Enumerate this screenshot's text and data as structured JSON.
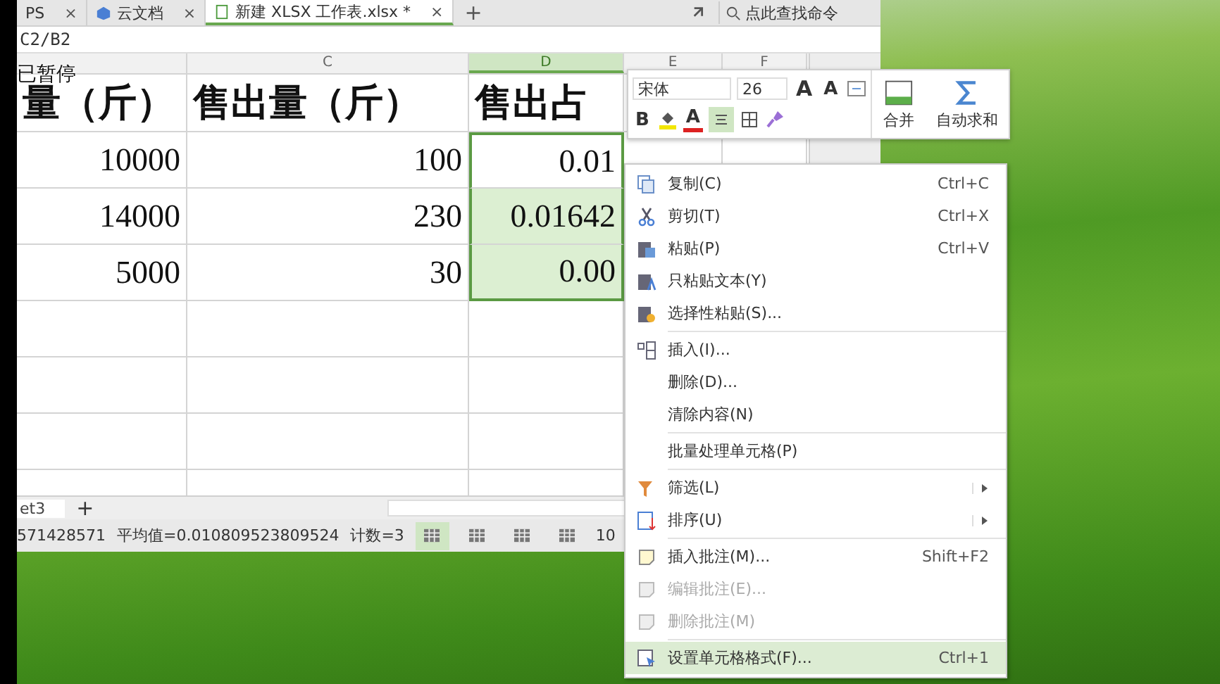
{
  "tabs": [
    {
      "label": "PS",
      "close": "×",
      "selected": false
    },
    {
      "label": "云文档",
      "close": "×",
      "selected": false
    },
    {
      "label": "新建 XLSX 工作表.xlsx *",
      "close": "×",
      "selected": true
    }
  ],
  "new_tab": "+",
  "search": {
    "placeholder": "点此查找命令"
  },
  "formula_bar": {
    "value": "C2/B2"
  },
  "paused_overlay": "已暂停",
  "sheet": {
    "columns": [
      {
        "label": "C",
        "selected": false
      },
      {
        "label": "D",
        "selected": true
      },
      {
        "label": "E",
        "selected": false
      },
      {
        "label": "F",
        "selected": false
      }
    ],
    "header_row": [
      "量（斤）",
      "售出量（斤）",
      "售出占"
    ],
    "rows": [
      {
        "cells": [
          {
            "text": "10000",
            "selected": false,
            "active": false
          },
          {
            "text": "100",
            "selected": false,
            "active": false
          },
          {
            "text": "0.01",
            "selected": true,
            "active": true
          }
        ]
      },
      {
        "cells": [
          {
            "text": "14000",
            "selected": false,
            "active": false
          },
          {
            "text": "230",
            "selected": false,
            "active": false
          },
          {
            "text": "0.01642",
            "selected": true,
            "active": false
          }
        ]
      },
      {
        "cells": [
          {
            "text": "5000",
            "selected": false,
            "active": false
          },
          {
            "text": "30",
            "selected": false,
            "active": false
          },
          {
            "text": "0.00",
            "selected": true,
            "active": false
          }
        ]
      }
    ]
  },
  "sheet_tabs": [
    {
      "label": "et3",
      "selected": true
    }
  ],
  "add_sheet": "+",
  "status_bar": {
    "items": [
      "571428571",
      "平均值=0.010809523809524",
      "计数=3"
    ],
    "views": [
      {
        "selected": true
      },
      {
        "selected": false
      },
      {
        "selected": false
      },
      {
        "selected": false
      }
    ],
    "zoom": "10"
  },
  "mini_toolbar": {
    "font": "宋体",
    "size": "26",
    "grow": "A",
    "shrink": "A",
    "bold": "B",
    "font_color": "A",
    "align_selected": true,
    "merge": "合并",
    "autosum": "自动求和"
  },
  "context_menu": [
    {
      "kind": "item",
      "label": "复制(C)",
      "shortcut": "Ctrl+C",
      "submenu": false,
      "disabled": false,
      "selected": false
    },
    {
      "kind": "item",
      "label": "剪切(T)",
      "shortcut": "Ctrl+X",
      "submenu": false,
      "disabled": false,
      "selected": false
    },
    {
      "kind": "item",
      "label": "粘贴(P)",
      "shortcut": "Ctrl+V",
      "submenu": false,
      "disabled": false,
      "selected": false
    },
    {
      "kind": "item",
      "label": "只粘贴文本(Y)",
      "submenu": false,
      "disabled": false,
      "selected": false
    },
    {
      "kind": "item",
      "label": "选择性粘贴(S)...",
      "submenu": false,
      "disabled": false,
      "selected": false
    },
    {
      "kind": "separator"
    },
    {
      "kind": "item",
      "label": "插入(I)...",
      "submenu": false,
      "disabled": false,
      "selected": false
    },
    {
      "kind": "item",
      "label": "删除(D)...",
      "submenu": false,
      "disabled": false,
      "selected": false
    },
    {
      "kind": "item",
      "label": "清除内容(N)",
      "submenu": false,
      "disabled": false,
      "selected": false
    },
    {
      "kind": "separator"
    },
    {
      "kind": "item",
      "label": "批量处理单元格(P)",
      "submenu": false,
      "disabled": false,
      "selected": false
    },
    {
      "kind": "separator"
    },
    {
      "kind": "item",
      "label": "筛选(L)",
      "submenu": true,
      "disabled": false,
      "selected": false
    },
    {
      "kind": "item",
      "label": "排序(U)",
      "submenu": true,
      "disabled": false,
      "selected": false
    },
    {
      "kind": "separator"
    },
    {
      "kind": "item",
      "label": "插入批注(M)...",
      "shortcut": "Shift+F2",
      "submenu": false,
      "disabled": false,
      "selected": false
    },
    {
      "kind": "item",
      "label": "编辑批注(E)...",
      "submenu": false,
      "disabled": true,
      "selected": false
    },
    {
      "kind": "item",
      "label": "删除批注(M)",
      "submenu": false,
      "disabled": true,
      "selected": false
    },
    {
      "kind": "separator"
    },
    {
      "kind": "item",
      "label": "设置单元格格式(F)...",
      "shortcut": "Ctrl+1",
      "submenu": false,
      "disabled": false,
      "selected": true
    }
  ]
}
